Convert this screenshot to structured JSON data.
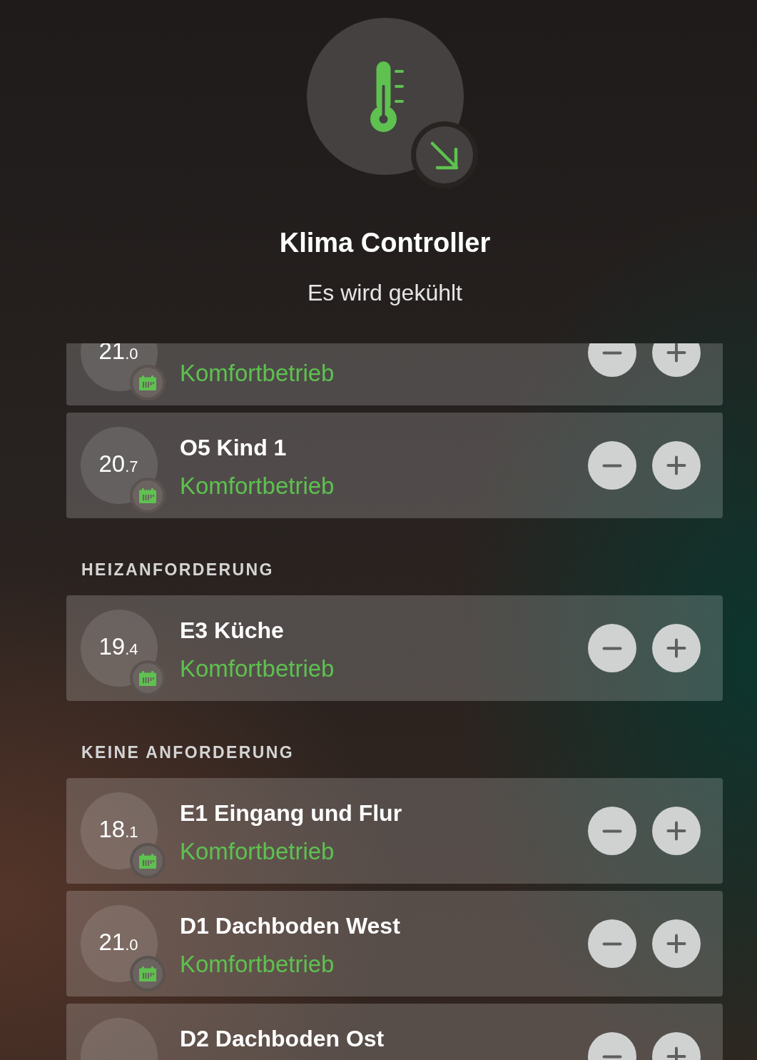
{
  "header": {
    "title": "Klima Controller",
    "status": "Es wird gekühlt"
  },
  "sections": [
    {
      "rooms": [
        {
          "temperature": "21.0",
          "mode": "Komfortbetrieb"
        },
        {
          "name": "O5 Kind 1",
          "temperature": "20.7",
          "mode": "Komfortbetrieb"
        }
      ]
    },
    {
      "heading": "HEIZANFORDERUNG",
      "rooms": [
        {
          "name": "E3 Küche",
          "temperature": "19.4",
          "mode": "Komfortbetrieb"
        }
      ]
    },
    {
      "heading": "KEINE ANFORDERUNG",
      "rooms": [
        {
          "name": "E1 Eingang und Flur",
          "temperature": "18.1",
          "mode": "Komfortbetrieb"
        },
        {
          "name": "D1 Dachboden West",
          "temperature": "21.0",
          "mode": "Komfortbetrieb"
        },
        {
          "name": "D2 Dachboden Ost"
        }
      ]
    }
  ]
}
